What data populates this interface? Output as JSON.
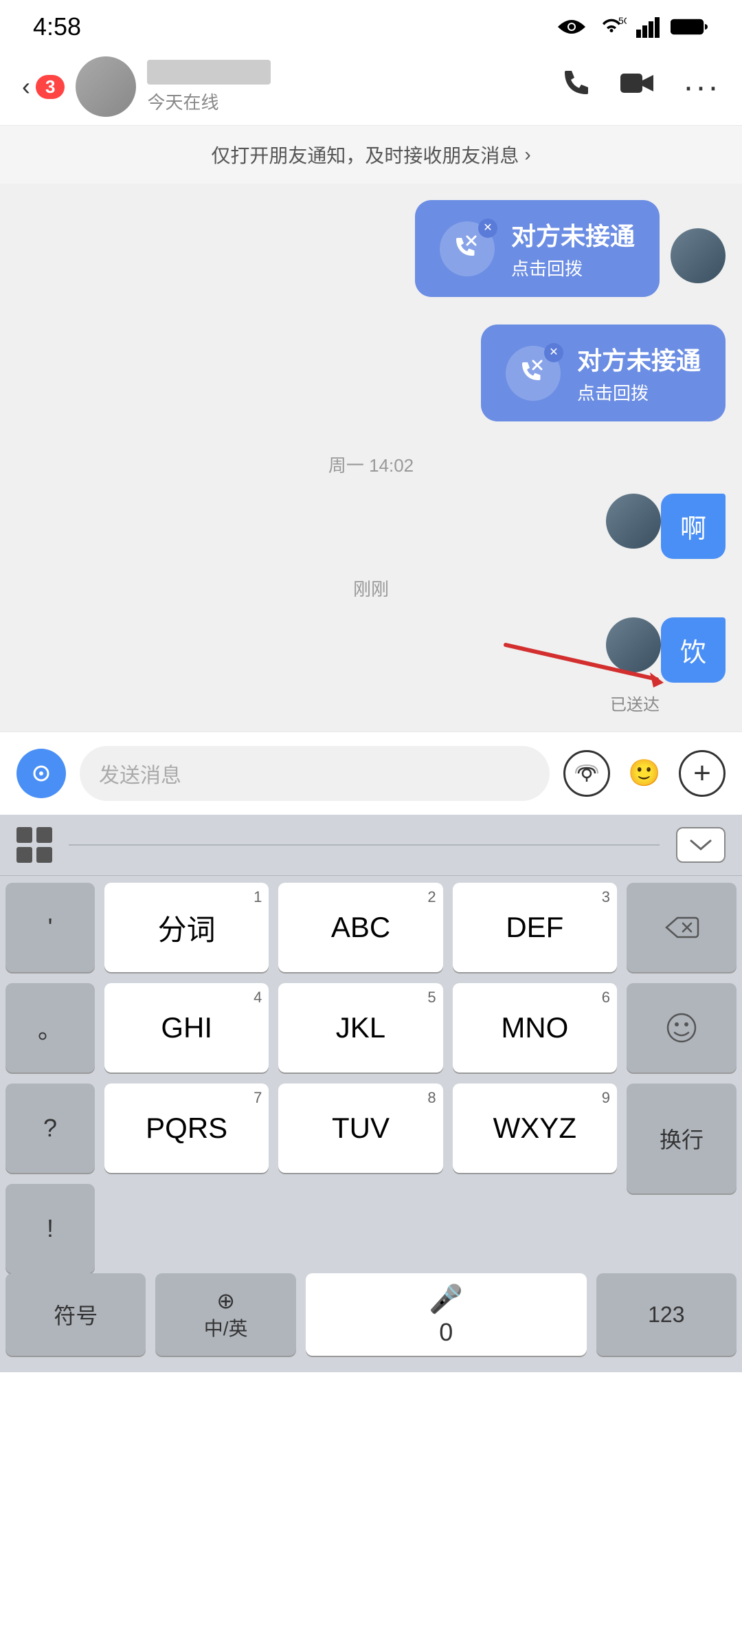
{
  "statusBar": {
    "time": "4:58"
  },
  "header": {
    "backLabel": "‹",
    "badge": "3",
    "contactStatus": "今天在线",
    "phoneIcon": "phone",
    "videoIcon": "video",
    "moreIcon": "more"
  },
  "notifBanner": {
    "text": "仅打开朋友通知，及时接收朋友消息",
    "arrow": "›"
  },
  "chat": {
    "missedCall1": {
      "mainText": "对方未接通",
      "subText": "点击回拨"
    },
    "missedCall2": {
      "mainText": "对方未接通",
      "subText": "点击回拨"
    },
    "timestamp1": "周一 14:02",
    "msg1": "啊",
    "timestamp2": "刚刚",
    "msg2": "饮",
    "msgStatus": "已送达"
  },
  "inputBar": {
    "placeholder": "发送消息",
    "voiceIcon": "voice",
    "soundwaveIcon": "soundwave",
    "emojiIcon": "emoji",
    "plusIcon": "plus"
  },
  "keyboard": {
    "gridIcon": "grid",
    "collapseIcon": "chevron-down",
    "keys": {
      "row1": [
        {
          "num": "1",
          "label": "分词"
        },
        {
          "num": "2",
          "label": "ABC"
        },
        {
          "num": "3",
          "label": "DEF"
        }
      ],
      "row2": [
        {
          "num": "4",
          "label": "GHI"
        },
        {
          "num": "5",
          "label": "JKL"
        },
        {
          "num": "6",
          "label": "MNO"
        }
      ],
      "row3": [
        {
          "num": "7",
          "label": "PQRS"
        },
        {
          "num": "8",
          "label": "TUV"
        },
        {
          "num": "9",
          "label": "WXYZ"
        }
      ],
      "leftKeys": [
        "'",
        "。",
        "?",
        "!"
      ],
      "bottomRow": [
        {
          "label": "符号"
        },
        {
          "label": "中/英",
          "subLabel": "⊕"
        },
        {
          "label": "0",
          "isMic": true
        },
        {
          "label": "123"
        }
      ],
      "enterLabel": "换行",
      "backspaceIcon": "backspace",
      "emojiKeyIcon": "emoji"
    }
  }
}
